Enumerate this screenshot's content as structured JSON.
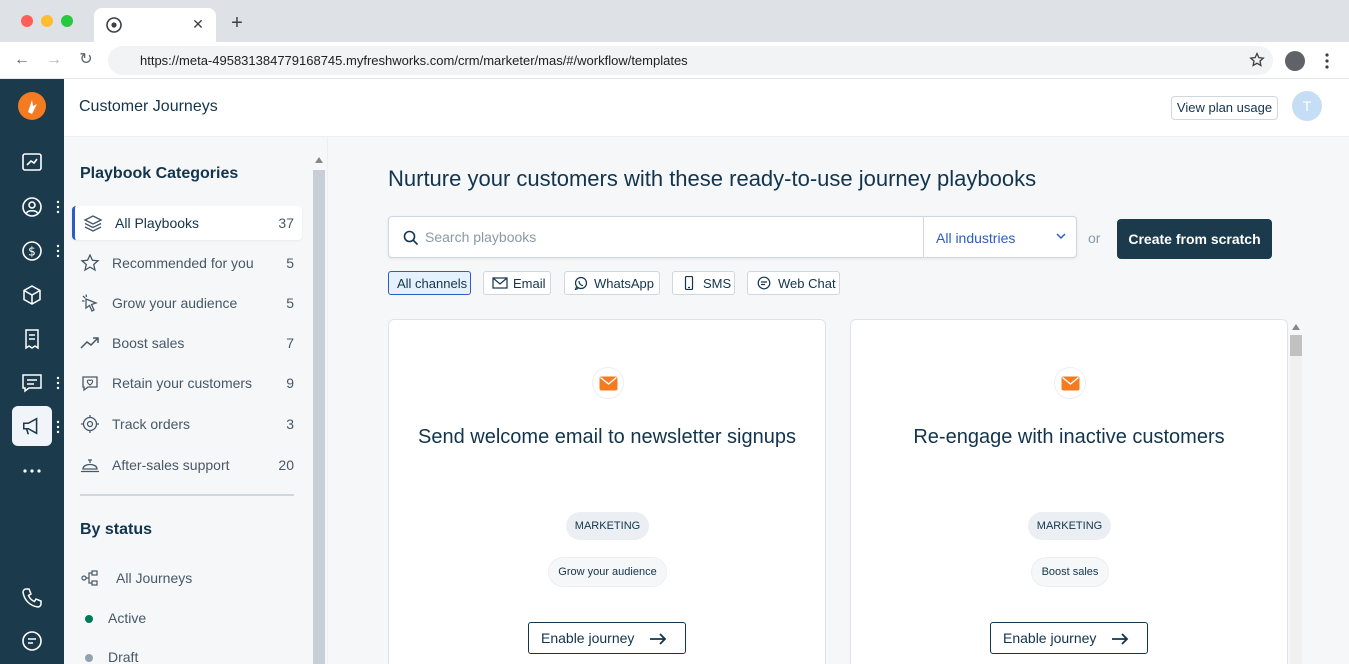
{
  "browser": {
    "url": "https://meta-495831384779168745.myfreshworks.com/crm/marketer/mas/#/workflow/templates"
  },
  "header": {
    "title": "Customer Journeys",
    "plan_button": "View plan usage",
    "avatar_initial": "T"
  },
  "sidebar": {
    "title": "Playbook Categories",
    "categories": [
      {
        "label": "All Playbooks",
        "count": "37",
        "icon": "layers-icon",
        "active": true
      },
      {
        "label": "Recommended for you",
        "count": "5",
        "icon": "star-icon"
      },
      {
        "label": "Grow your audience",
        "count": "5",
        "icon": "sparkle-cursor-icon"
      },
      {
        "label": "Boost sales",
        "count": "7",
        "icon": "trend-up-icon"
      },
      {
        "label": "Retain your customers",
        "count": "9",
        "icon": "chat-heart-icon"
      },
      {
        "label": "Track orders",
        "count": "3",
        "icon": "target-icon"
      },
      {
        "label": "After-sales support",
        "count": "20",
        "icon": "service-bell-icon"
      }
    ],
    "status_title": "By status",
    "statuses": [
      {
        "label": "All Journeys",
        "icon": "flow-icon"
      },
      {
        "label": "Active",
        "color": "#00795b"
      },
      {
        "label": "Draft",
        "color": "#92a2b1"
      }
    ]
  },
  "main": {
    "headline": "Nurture your customers with these ready-to-use journey playbooks",
    "search_placeholder": "Search playbooks",
    "industry_select": "All industries",
    "or_text": "or",
    "create_button": "Create from scratch",
    "channels": [
      {
        "label": "All channels",
        "active": true
      },
      {
        "label": "Email",
        "icon": "mail-icon"
      },
      {
        "label": "WhatsApp",
        "icon": "whatsapp-icon"
      },
      {
        "label": "SMS",
        "icon": "phone-icon"
      },
      {
        "label": "Web Chat",
        "icon": "chat-icon"
      }
    ],
    "cards": [
      {
        "title": "Send welcome email to newsletter signups",
        "badge": "MARKETING",
        "tag": "Grow your audience",
        "button": "Enable journey"
      },
      {
        "title": "Re-engage with inactive customers",
        "badge": "MARKETING",
        "tag": "Boost sales",
        "button": "Enable journey"
      }
    ]
  },
  "colors": {
    "rail": "#1b3a4b",
    "accent": "#2c5cc5",
    "brand_orange": "#f47b20",
    "primary_button": "#1b3a4b"
  }
}
